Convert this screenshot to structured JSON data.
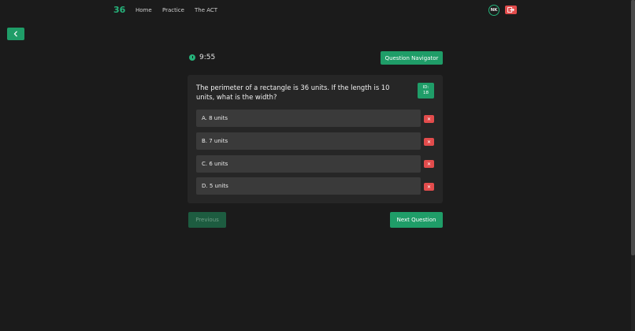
{
  "nav": {
    "brand": "36",
    "links": [
      "Home",
      "Practice",
      "The ACT"
    ],
    "avatar_initials": "NK"
  },
  "timer": {
    "time": "9:55"
  },
  "question_navigator_label": "Question Navigator",
  "question": {
    "text": "The perimeter of a rectangle is 36 units. If the length is 10 units, what is the width?",
    "id_label": "ID:",
    "id_value": "18",
    "options": [
      "A. 8 units",
      "B. 7 units",
      "C. 6 units",
      "D. 5 units"
    ],
    "eliminate_symbol": "✕"
  },
  "footer": {
    "previous_label": "Previous",
    "next_label": "Next Question"
  },
  "colors": {
    "accent": "#1f9d68",
    "danger": "#e24c4c",
    "background": "#1b1b1b",
    "card": "#262626",
    "option": "#3a3a3a"
  }
}
